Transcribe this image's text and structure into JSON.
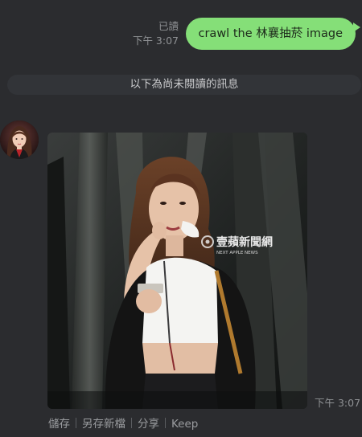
{
  "outgoing": {
    "read_status": "已讀",
    "time": "下午 3:07",
    "text": "crawl the 林襄抽菸 image"
  },
  "divider": {
    "label": "以下為尚未閱讀的訊息"
  },
  "incoming": {
    "image_watermark": "壹蘋新聞網",
    "image_watermark_sub": "NEXT APPLE NEWS",
    "time": "下午 3:07",
    "actions": [
      "儲存",
      "另存新檔",
      "分享",
      "Keep"
    ]
  },
  "colors": {
    "background": "#2b2c2f",
    "outgoing_bubble": "#85df78",
    "divider_bg": "#323438"
  }
}
